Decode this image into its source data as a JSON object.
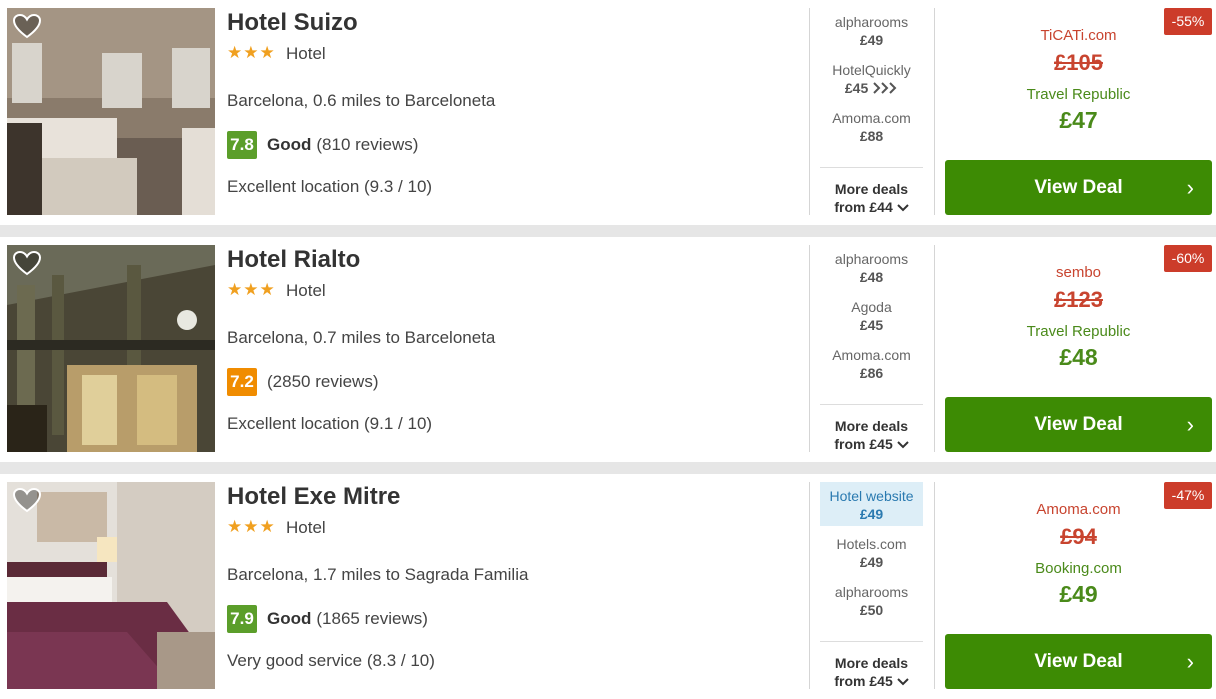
{
  "hotels": [
    {
      "name": "Hotel Suizo",
      "stars": "★★★",
      "type": "Hotel",
      "location": "Barcelona, 0.6 miles to Barceloneta",
      "score": "7.8",
      "score_color": "#5b9e2a",
      "rating_word": "Good",
      "reviews": "(810 reviews)",
      "extra": "Excellent location (9.3 / 10)",
      "deals": [
        {
          "site": "alpharooms",
          "price": "£49"
        },
        {
          "site": "HotelQuickly",
          "price": "£45",
          "icon": "triple-chevron-right-icon"
        },
        {
          "site": "Amoma.com",
          "price": "£88"
        }
      ],
      "more_label": "More deals",
      "more_from": "from £44",
      "discount": "-55%",
      "original_site": "TiCATi.com",
      "original_price": "£105",
      "best_site": "Travel Republic",
      "best_price": "£47",
      "cta": "View Deal"
    },
    {
      "name": "Hotel Rialto",
      "stars": "★★★",
      "type": "Hotel",
      "location": "Barcelona, 0.7 miles to Barceloneta",
      "score": "7.2",
      "score_color": "#f08c00",
      "rating_word": "",
      "reviews": "(2850 reviews)",
      "extra": "Excellent location (9.1 / 10)",
      "deals": [
        {
          "site": "alpharooms",
          "price": "£48"
        },
        {
          "site": "Agoda",
          "price": "£45"
        },
        {
          "site": "Amoma.com",
          "price": "£86"
        }
      ],
      "more_label": "More deals",
      "more_from": "from £45",
      "discount": "-60%",
      "original_site": "sembo",
      "original_price": "£123",
      "best_site": "Travel Republic",
      "best_price": "£48",
      "cta": "View Deal"
    },
    {
      "name": "Hotel Exe Mitre",
      "stars": "★★★",
      "type": "Hotel",
      "location": "Barcelona, 1.7 miles to Sagrada Familia",
      "score": "7.9",
      "score_color": "#5b9e2a",
      "rating_word": "Good",
      "reviews": "(1865 reviews)",
      "extra": "Very good service (8.3 / 10)",
      "deals": [
        {
          "site": "Hotel website",
          "price": "£49",
          "highlight": true
        },
        {
          "site": "Hotels.com",
          "price": "£49"
        },
        {
          "site": "alpharooms",
          "price": "£50"
        }
      ],
      "more_label": "More deals",
      "more_from": "from £45",
      "discount": "-47%",
      "original_site": "Amoma.com",
      "original_price": "£94",
      "best_site": "Booking.com",
      "best_price": "£49",
      "cta": "View Deal"
    }
  ],
  "icons": {
    "favorite": "heart-outline-icon",
    "expand": "chevron-down-icon",
    "cta": "chevron-right-icon"
  }
}
